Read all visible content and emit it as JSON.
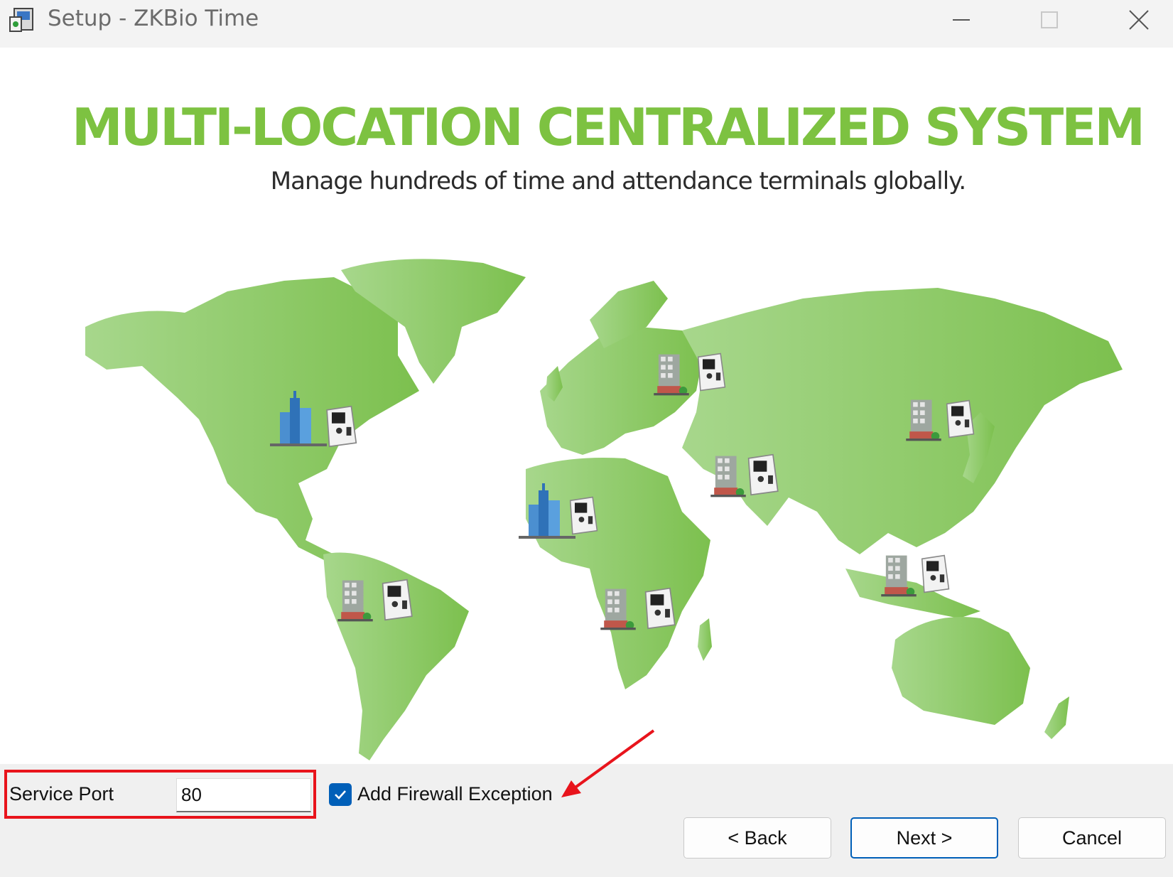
{
  "window": {
    "title": "Setup - ZKBio Time",
    "controls": [
      "minimize",
      "maximize",
      "close"
    ]
  },
  "banner": {
    "headline": "MULTI-LOCATION CENTRALIZED SYSTEM",
    "subheadline": "Manage hundreds of time and attendance terminals globally."
  },
  "form": {
    "service_port_label": "Service Port",
    "service_port_value": "80",
    "firewall_label": "Add Firewall Exception",
    "firewall_checked": true
  },
  "buttons": {
    "back": "< Back",
    "next": "Next >",
    "cancel": "Cancel"
  },
  "colors": {
    "brand_green": "#7dc241",
    "accent_blue": "#005fb8",
    "annotation_red": "#e8141c"
  }
}
